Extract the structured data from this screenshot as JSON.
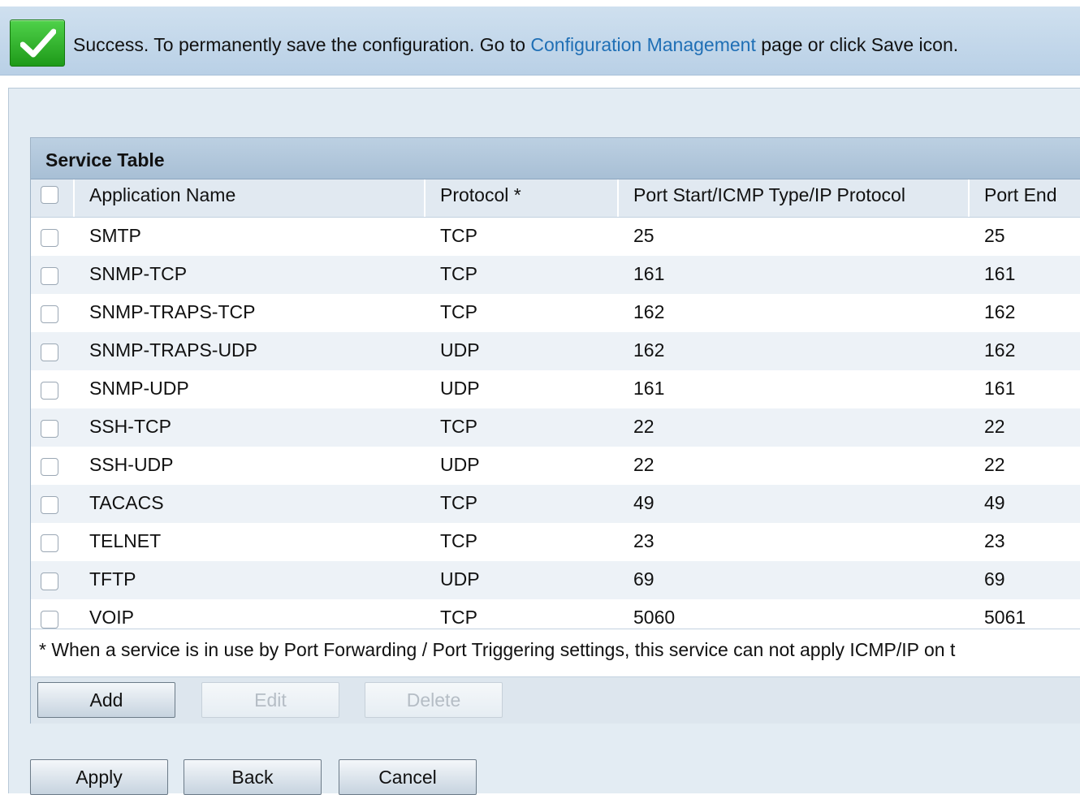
{
  "banner": {
    "text_before": "Success. To permanently save the configuration. Go to ",
    "link_text": "Configuration Management",
    "text_after": " page or click Save icon."
  },
  "table": {
    "title": "Service Table",
    "headers": {
      "app_name": "Application Name",
      "protocol": "Protocol *",
      "port_start": "Port Start/ICMP Type/IP Protocol",
      "port_end": "Port End"
    },
    "rows": [
      {
        "name": "SMTP",
        "protocol": "TCP",
        "port_start": "25",
        "port_end": "25"
      },
      {
        "name": "SNMP-TCP",
        "protocol": "TCP",
        "port_start": "161",
        "port_end": "161"
      },
      {
        "name": "SNMP-TRAPS-TCP",
        "protocol": "TCP",
        "port_start": "162",
        "port_end": "162"
      },
      {
        "name": "SNMP-TRAPS-UDP",
        "protocol": "UDP",
        "port_start": "162",
        "port_end": "162"
      },
      {
        "name": "SNMP-UDP",
        "protocol": "UDP",
        "port_start": "161",
        "port_end": "161"
      },
      {
        "name": "SSH-TCP",
        "protocol": "TCP",
        "port_start": "22",
        "port_end": "22"
      },
      {
        "name": "SSH-UDP",
        "protocol": "UDP",
        "port_start": "22",
        "port_end": "22"
      },
      {
        "name": "TACACS",
        "protocol": "TCP",
        "port_start": "49",
        "port_end": "49"
      },
      {
        "name": "TELNET",
        "protocol": "TCP",
        "port_start": "23",
        "port_end": "23"
      },
      {
        "name": "TFTP",
        "protocol": "UDP",
        "port_start": "69",
        "port_end": "69"
      },
      {
        "name": "VOIP",
        "protocol": "TCP",
        "port_start": "5060",
        "port_end": "5061"
      }
    ],
    "footnote": "* When a service is in use by Port Forwarding / Port Triggering settings, this service can not apply ICMP/IP on t",
    "buttons": {
      "add": "Add",
      "edit": "Edit",
      "delete": "Delete"
    }
  },
  "actions": {
    "apply": "Apply",
    "back": "Back",
    "cancel": "Cancel"
  },
  "colors": {
    "link": "#1f6fb5",
    "success_green": "#2fb52a",
    "header_bar": "#b2c7dc"
  },
  "icons": {
    "success": "check-icon"
  }
}
